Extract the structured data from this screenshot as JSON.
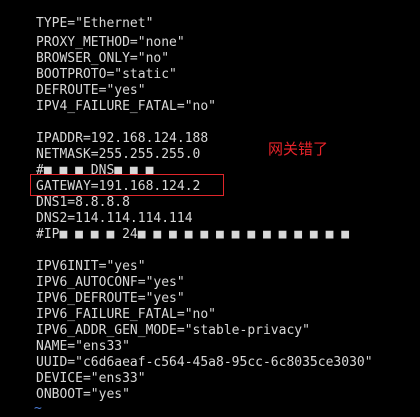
{
  "terminal": {
    "lines": [
      "TYPE=\"Ethernet\"",
      "PROXY_METHOD=\"none\"",
      "BROWSER_ONLY=\"no\"",
      "BOOTPROTO=\"static\"",
      "DEFROUTE=\"yes\"",
      "IPV4_FAILURE_FATAL=\"no\"",
      "",
      "IPADDR=192.168.124.188",
      "NETMASK=255.255.255.0",
      "#■ ■ ■ DNS■ ■ ■",
      "GATEWAY=191.168.124.2",
      "DNS1=8.8.8.8",
      "DNS2=114.114.114.114",
      "#IP■ ■ ■ ■ 24■ ■ ■ ■ ■ ■ ■ ■ ■ ■ ■ ■ ■ ■",
      "",
      "IPV6INIT=\"yes\"",
      "IPV6_AUTOCONF=\"yes\"",
      "IPV6_DEFROUTE=\"yes\"",
      "IPV6_FAILURE_FATAL=\"no\"",
      "IPV6_ADDR_GEN_MODE=\"stable-privacy\"",
      "NAME=\"ens33\"",
      "UUID=\"c6d6aeaf-c564-45a8-95cc-6c8035ce3030\"",
      "DEVICE=\"ens33\"",
      "ONBOOT=\"yes\""
    ],
    "tilde": "~"
  },
  "annotation": {
    "text": "网关错了"
  },
  "colors": {
    "background": "#000000",
    "text": "#d8d8d8",
    "highlight": "#e0262a",
    "tilde": "#4a7bd6"
  }
}
